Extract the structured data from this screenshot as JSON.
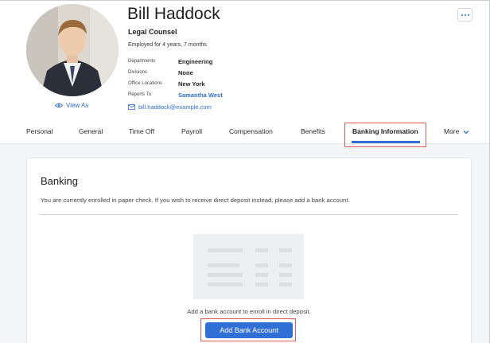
{
  "profile": {
    "name": "Bill Haddock",
    "title": "Legal Counsel",
    "tenure": "Employed for 4 years, 7 months",
    "details": [
      {
        "label": "Departments",
        "value": "Engineering",
        "link": false
      },
      {
        "label": "Divisions",
        "value": "None",
        "link": false
      },
      {
        "label": "Office Locations",
        "value": "New York",
        "link": false
      },
      {
        "label": "Reports To",
        "value": "Samantha West",
        "link": true
      }
    ],
    "email": "bill.haddock@example.com",
    "view_as": "View As",
    "avatar_icon": "person-photo-icon",
    "more_icon": "more-dots-icon"
  },
  "tabs": [
    {
      "label": "Personal",
      "active": false
    },
    {
      "label": "General",
      "active": false
    },
    {
      "label": "Time Off",
      "active": false
    },
    {
      "label": "Payroll",
      "active": false
    },
    {
      "label": "Compensation",
      "active": false
    },
    {
      "label": "Benefits",
      "active": false
    },
    {
      "label": "Banking Information",
      "active": true
    },
    {
      "label": "More",
      "active": false
    }
  ],
  "banking": {
    "title": "Banking",
    "description": "You are currently enrolled in paper check. If you wish to receive direct deposit instead, please add a bank account.",
    "empty_text": "Add a bank account to enroll in direct deposit.",
    "add_button_label": "Add Bank Account"
  },
  "colors": {
    "accent": "#2f6fd6",
    "highlight": "#e05a5a",
    "background": "#f4f5f7"
  }
}
